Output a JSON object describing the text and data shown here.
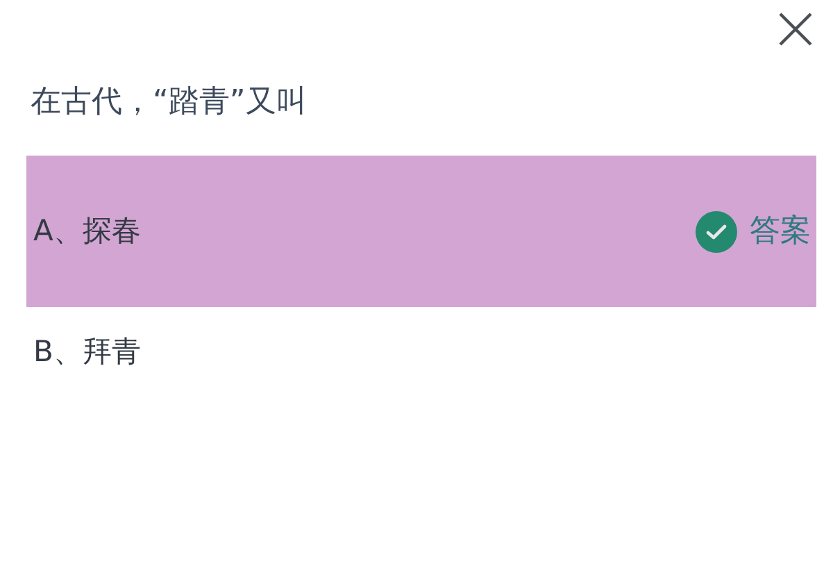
{
  "question": "在古代，“踏青”又叫",
  "options": [
    {
      "label": "A、探春",
      "selected": true,
      "answer_label": "答案"
    },
    {
      "label": "B、拜青",
      "selected": false
    }
  ]
}
